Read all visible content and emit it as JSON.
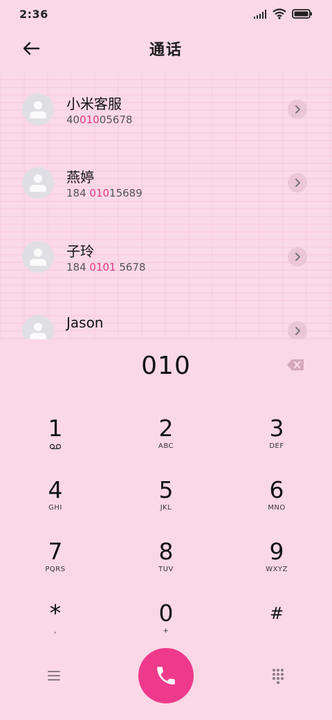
{
  "status_bar": {
    "time": "2:36",
    "icons": [
      "signal-icon",
      "wifi-icon",
      "battery-icon"
    ]
  },
  "header": {
    "title": "通话",
    "back_icon": "back-arrow-icon"
  },
  "results": [
    {
      "name": "小米客服",
      "number_parts": [
        [
          "40",
          false
        ],
        [
          "010",
          true
        ],
        [
          "05678",
          false
        ]
      ],
      "detail_icon": "chevron-right-icon"
    },
    {
      "name": "燕婷",
      "number_parts": [
        [
          "184 ",
          false
        ],
        [
          "010",
          true
        ],
        [
          "15689",
          false
        ]
      ],
      "detail_icon": "chevron-right-icon"
    },
    {
      "name": "子玲",
      "number_parts": [
        [
          "184 ",
          false
        ],
        [
          "0101",
          true
        ],
        [
          " 5678",
          false
        ]
      ],
      "detail_icon": "chevron-right-icon"
    },
    {
      "name": "Jason",
      "number_parts": [],
      "detail_icon": "chevron-right-icon"
    }
  ],
  "dialer": {
    "dialed": "010",
    "backspace_icon": "backspace-icon",
    "keys": [
      {
        "digit": "1",
        "letters": "",
        "sub_icon": "voicemail-icon"
      },
      {
        "digit": "2",
        "letters": "ABC"
      },
      {
        "digit": "3",
        "letters": "DEF"
      },
      {
        "digit": "4",
        "letters": "GHI"
      },
      {
        "digit": "5",
        "letters": "JKL"
      },
      {
        "digit": "6",
        "letters": "MNO"
      },
      {
        "digit": "7",
        "letters": "PQRS"
      },
      {
        "digit": "8",
        "letters": "TUV"
      },
      {
        "digit": "9",
        "letters": "WXYZ"
      },
      {
        "digit": "*",
        "letters": ","
      },
      {
        "digit": "0",
        "letters": "+"
      },
      {
        "digit": "#",
        "letters": ""
      }
    ]
  },
  "bottom_bar": {
    "menu_icon": "menu-icon",
    "call_icon": "phone-icon",
    "keypad_icon": "dialpad-icon"
  },
  "colors": {
    "background": "#fad8e6",
    "accent": "#ef3a8c",
    "highlight": "#e0377f"
  }
}
